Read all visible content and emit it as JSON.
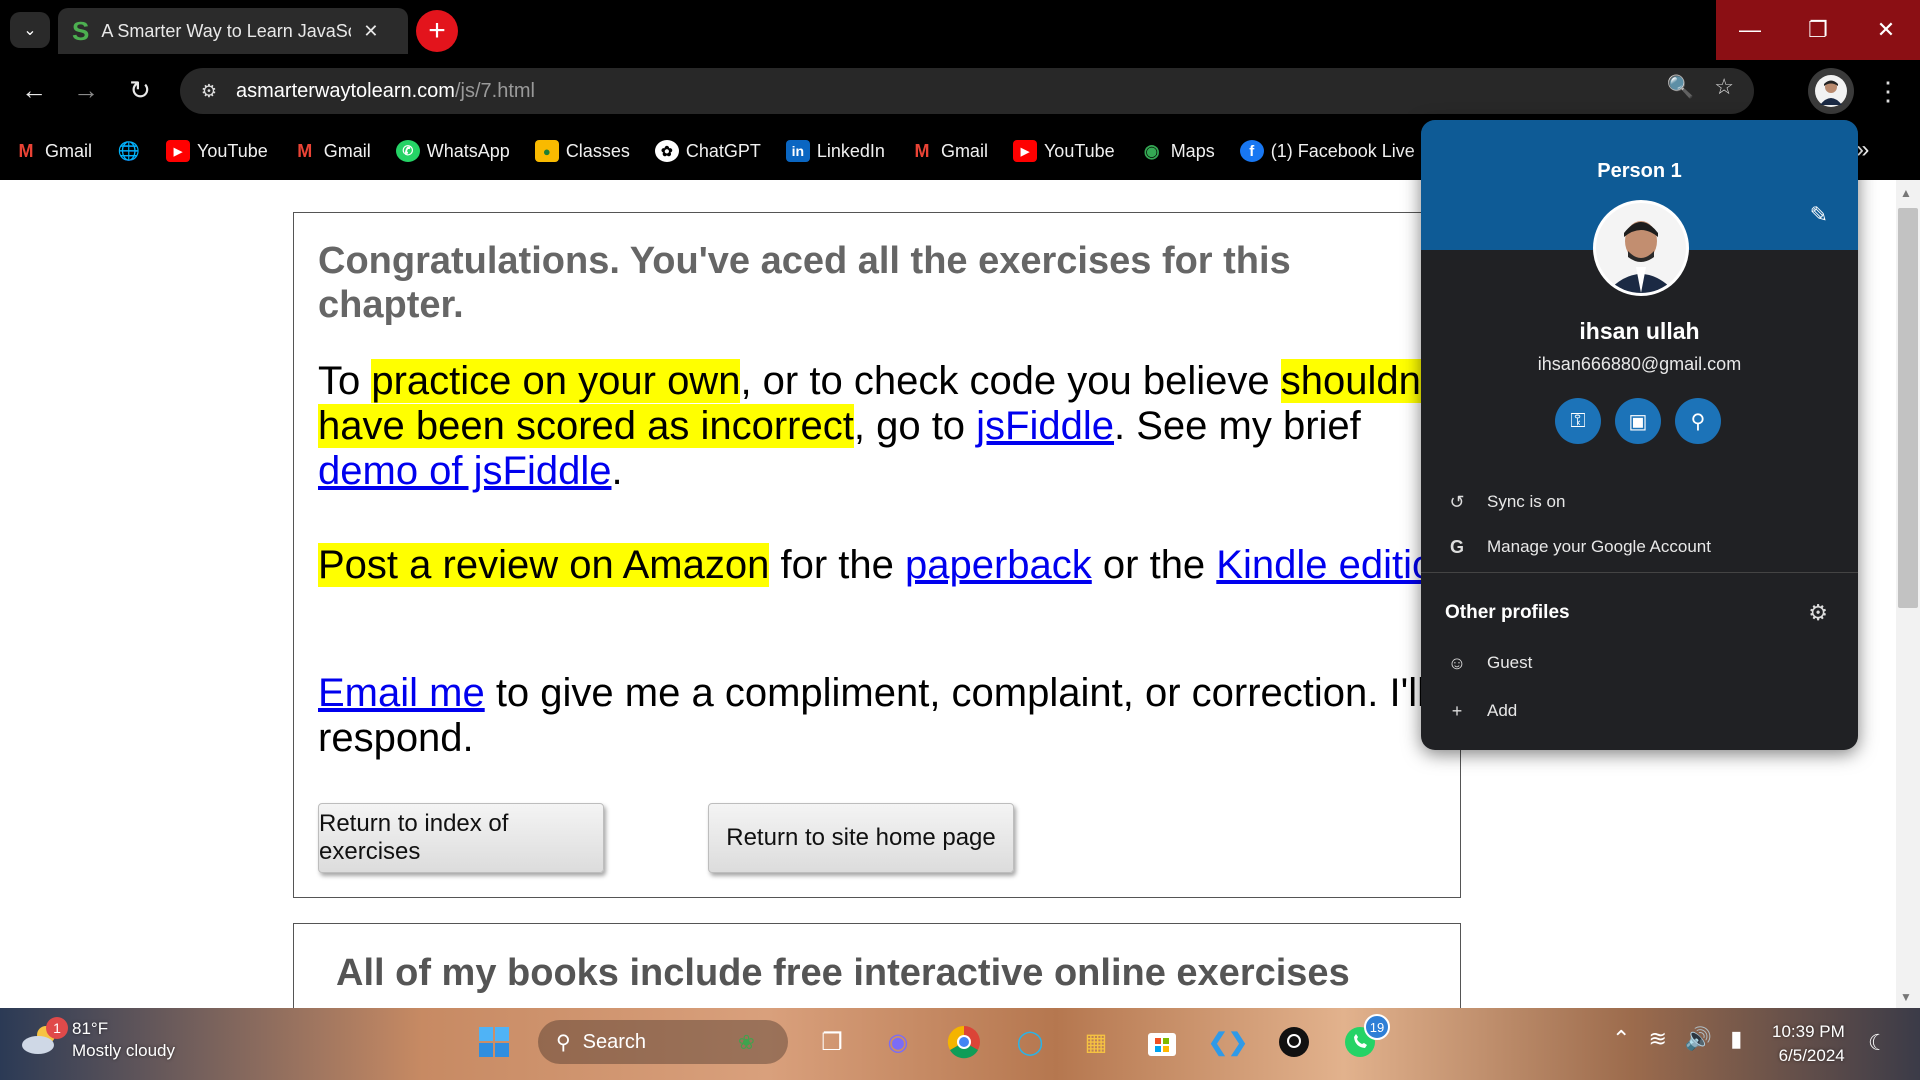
{
  "browser": {
    "tab_title": "A Smarter Way to Learn JavaScr",
    "tab_favicon": "S",
    "url_host": "asmarterwaytolearn.com",
    "url_path": "/js/7.html"
  },
  "bookmarks": [
    {
      "label": "Gmail",
      "icon": "gmail-icon"
    },
    {
      "label": "",
      "icon": "globe-icon"
    },
    {
      "label": "YouTube",
      "icon": "youtube-icon"
    },
    {
      "label": "Gmail",
      "icon": "gmail-icon"
    },
    {
      "label": "WhatsApp",
      "icon": "whatsapp-icon"
    },
    {
      "label": "Classes",
      "icon": "classroom-icon"
    },
    {
      "label": "ChatGPT",
      "icon": "chatgpt-icon"
    },
    {
      "label": "LinkedIn",
      "icon": "linkedin-icon"
    },
    {
      "label": "Gmail",
      "icon": "gmail-icon"
    },
    {
      "label": "YouTube",
      "icon": "youtube-icon"
    },
    {
      "label": "Maps",
      "icon": "maps-icon"
    },
    {
      "label": "(1) Facebook Live |",
      "icon": "facebook-icon"
    }
  ],
  "content": {
    "congrats": "Congratulations. You've aced all the exercises for this chapter.",
    "p1": {
      "t1": "To ",
      "h1": "practice on your own",
      "t2": ", or to check code you believe ",
      "h2": "shouldn't have been scored as incorrect",
      "t3": ", go to ",
      "link1": "jsFiddle",
      "t4": ". See my brief ",
      "link2": "demo of jsFiddle",
      "t5": "."
    },
    "p2": {
      "h1": "Post a review on Amazon",
      "t1": " for the ",
      "link1": "paperback",
      "t2": " or the ",
      "link2": "Kindle edition",
      "t3": "."
    },
    "p3": {
      "link1": "Email me",
      "t1": " to give me a compliment, complaint, or correction. I'll respond."
    },
    "btn_index": "Return to index of exercises",
    "btn_home": "Return to site home page",
    "books_title": "All of my books include free interactive online exercises"
  },
  "profile": {
    "header_name": "Person 1",
    "user_name": "ihsan ullah",
    "email": "ihsan666880@gmail.com",
    "sync": "Sync is on",
    "manage": "Manage your Google Account",
    "other_profiles": "Other profiles",
    "guest": "Guest",
    "add": "Add"
  },
  "taskbar": {
    "weather_temp": "81°F",
    "weather_desc": "Mostly cloudy",
    "weather_badge": "1",
    "search": "Search",
    "whatsapp_badge": "19",
    "time": "10:39 PM",
    "date": "6/5/2024"
  },
  "colors": {
    "highlight": "#ffff00",
    "link": "#0000ee",
    "profile_header": "#0e5b96",
    "new_tab_button": "#e3141c",
    "window_controls": "#8b0f14"
  }
}
